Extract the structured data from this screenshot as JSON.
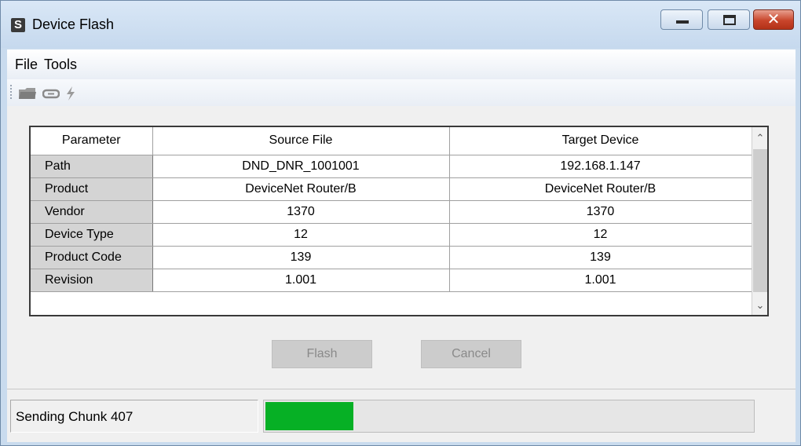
{
  "window": {
    "title": "Device Flash",
    "app_icon_glyph": "S",
    "minimize_icon": "minimize-icon",
    "maximize_icon": "maximize-icon",
    "close_icon": "close-icon",
    "close_glyph": "✕"
  },
  "menu": {
    "items": [
      "File",
      "Tools"
    ]
  },
  "toolbar": {
    "icons": [
      "open-folder-icon",
      "connect-link-icon",
      "flash-bolt-icon"
    ]
  },
  "table": {
    "headers": [
      "Parameter",
      "Source File",
      "Target Device"
    ],
    "rows": [
      [
        "Path",
        "DND_DNR_1001001",
        "192.168.1.147"
      ],
      [
        "Product",
        "DeviceNet Router/B",
        "DeviceNet Router/B"
      ],
      [
        "Vendor",
        "1370",
        "1370"
      ],
      [
        "Device Type",
        "12",
        "12"
      ],
      [
        "Product Code",
        "139",
        "139"
      ],
      [
        "Revision",
        "1.001",
        "1.001"
      ]
    ]
  },
  "buttons": {
    "flash": "Flash",
    "cancel": "Cancel"
  },
  "status": {
    "text": "Sending Chunk 407",
    "progress_fraction": 0.18,
    "progress_color": "#06b025"
  }
}
